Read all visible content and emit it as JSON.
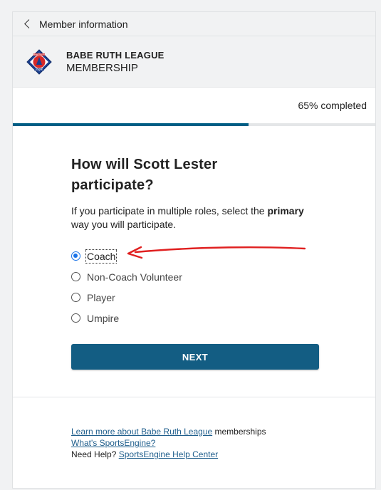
{
  "back": {
    "label": "Member information"
  },
  "org": {
    "name": "BABE RUTH LEAGUE",
    "subtitle": "MEMBERSHIP",
    "logo_text": "BABE RUTH",
    "logo_sub": "LEAGUE"
  },
  "progress": {
    "percent": 65,
    "label": "65% completed"
  },
  "question": {
    "title": "How will Scott Lester participate?",
    "instruction_before": "If you participate in multiple roles, select the ",
    "instruction_emphasis": "primary",
    "instruction_after": " way you will participate."
  },
  "options": [
    {
      "label": "Coach",
      "selected": true
    },
    {
      "label": "Non-Coach Volunteer",
      "selected": false
    },
    {
      "label": "Player",
      "selected": false
    },
    {
      "label": "Umpire",
      "selected": false
    }
  ],
  "next_label": "NEXT",
  "footer": {
    "learn_link": "Learn more about Babe Ruth League",
    "learn_suffix": " memberships",
    "whats_link": "What's SportsEngine?",
    "help_prefix": "Need Help? ",
    "help_link": "SportsEngine Help Center"
  },
  "colors": {
    "accent": "#005e85",
    "button": "#135d83",
    "radio": "#1a73e8",
    "annotation": "#e02020"
  }
}
